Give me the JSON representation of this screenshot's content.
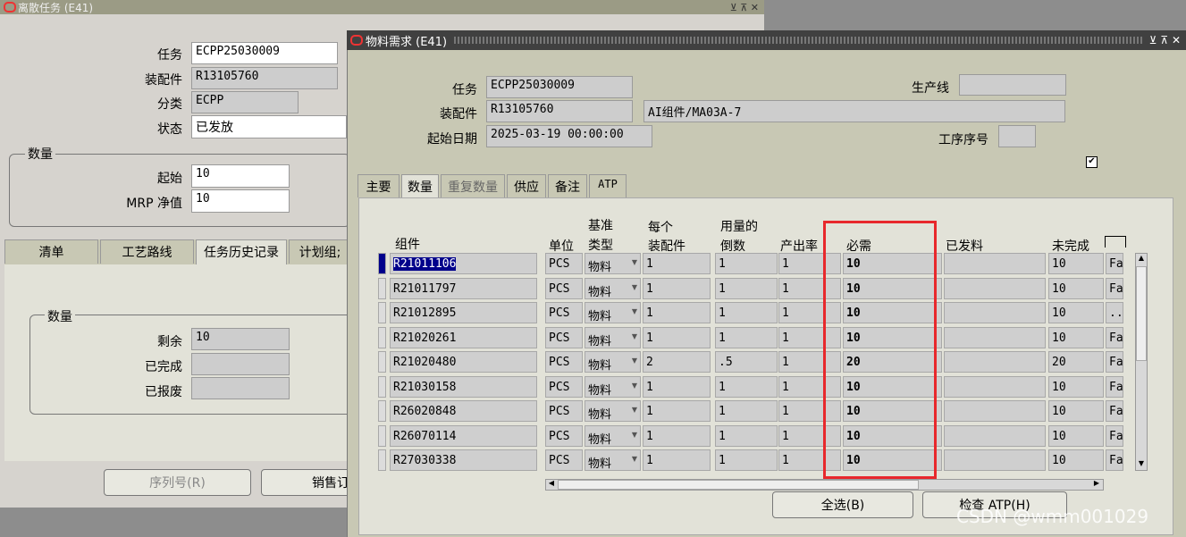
{
  "back_window": {
    "title": "离散任务 (E41)",
    "fields": {
      "task_label": "任务",
      "task_value": "ECPP25030009",
      "assembly_label": "装配件",
      "assembly_value": "R13105760",
      "class_label": "分类",
      "class_value": "ECPP",
      "status_label": "状态",
      "status_value": "已发放"
    },
    "qty_group": {
      "title": "数量",
      "start_label": "起始",
      "start_value": "10",
      "mrp_label": "MRP 净值",
      "mrp_value": "10"
    },
    "tabs": [
      "清单",
      "工艺路线",
      "任务历史记录",
      "计划组;"
    ],
    "qty2_group": {
      "title": "数量",
      "remaining_label": "剩余",
      "remaining_value": "10",
      "completed_label": "已完成",
      "scrapped_label": "已报废"
    },
    "buttons": {
      "serial": "序列号(R)",
      "sales": "销售订"
    }
  },
  "front_window": {
    "title": "物料需求 (E41)",
    "header": {
      "task_label": "任务",
      "task_value": "ECPP25030009",
      "assembly_label": "装配件",
      "assembly_value": "R13105760",
      "assembly_desc": "AI组件/MA03A-7",
      "start_date_label": "起始日期",
      "start_date_value": "2025-03-19 00:00:00",
      "line_label": "生产线",
      "op_seq_label": "工序序号"
    },
    "tabs": [
      "主要",
      "数量",
      "重复数量",
      "供应",
      "备注",
      "ATP"
    ],
    "columns": {
      "component": "组件",
      "uom": "单位",
      "basis_1": "基准",
      "basis_2": "类型",
      "per_1": "每个",
      "per_2": "装配件",
      "inv_1": "用量的",
      "inv_2": "倒数",
      "yield": "产出率",
      "required": "必需",
      "issued": "已发料",
      "open": "未完成"
    },
    "rows": [
      {
        "component": "R21011106",
        "uom": "PCS",
        "basis": "物料",
        "per": "1",
        "inverse": "1",
        "yield": "1",
        "required": "10",
        "issued": "",
        "open": "10",
        "extra": "Fa"
      },
      {
        "component": "R21011797",
        "uom": "PCS",
        "basis": "物料",
        "per": "1",
        "inverse": "1",
        "yield": "1",
        "required": "10",
        "issued": "",
        "open": "10",
        "extra": "Fa"
      },
      {
        "component": "R21012895",
        "uom": "PCS",
        "basis": "物料",
        "per": "1",
        "inverse": "1",
        "yield": "1",
        "required": "10",
        "issued": "",
        "open": "10",
        "extra": ".."
      },
      {
        "component": "R21020261",
        "uom": "PCS",
        "basis": "物料",
        "per": "1",
        "inverse": "1",
        "yield": "1",
        "required": "10",
        "issued": "",
        "open": "10",
        "extra": "Fa"
      },
      {
        "component": "R21020480",
        "uom": "PCS",
        "basis": "物料",
        "per": "2",
        "inverse": ".5",
        "yield": "1",
        "required": "20",
        "issued": "",
        "open": "20",
        "extra": "Fa"
      },
      {
        "component": "R21030158",
        "uom": "PCS",
        "basis": "物料",
        "per": "1",
        "inverse": "1",
        "yield": "1",
        "required": "10",
        "issued": "",
        "open": "10",
        "extra": "Fa"
      },
      {
        "component": "R26020848",
        "uom": "PCS",
        "basis": "物料",
        "per": "1",
        "inverse": "1",
        "yield": "1",
        "required": "10",
        "issued": "",
        "open": "10",
        "extra": "Fa"
      },
      {
        "component": "R26070114",
        "uom": "PCS",
        "basis": "物料",
        "per": "1",
        "inverse": "1",
        "yield": "1",
        "required": "10",
        "issued": "",
        "open": "10",
        "extra": "Fa"
      },
      {
        "component": "R27030338",
        "uom": "PCS",
        "basis": "物料",
        "per": "1",
        "inverse": "1",
        "yield": "1",
        "required": "10",
        "issued": "",
        "open": "10",
        "extra": "Fa"
      }
    ],
    "buttons": {
      "select_all": "全选(B)",
      "check_atp": "检查 ATP(H)"
    },
    "watermark": "CSDN @wmm001029",
    "highlight_color": "#e8282c"
  }
}
